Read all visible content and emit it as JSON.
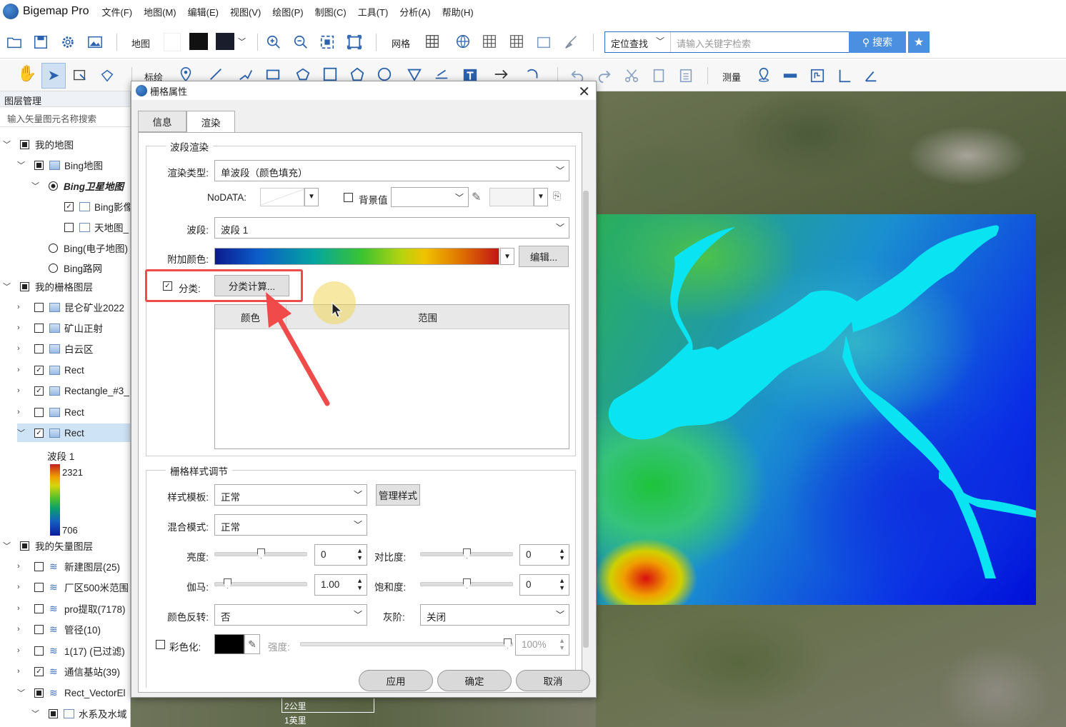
{
  "app": {
    "name": "Bigemap Pro"
  },
  "menu": [
    "文件(F)",
    "地图(M)",
    "编辑(E)",
    "视图(V)",
    "绘图(P)",
    "制图(C)",
    "工具(T)",
    "分析(A)",
    "帮助(H)"
  ],
  "toolbar1": {
    "map_label": "地图",
    "grid_label": "网格",
    "search_mode": "定位查找",
    "search_placeholder": "请输入关键字检索",
    "search_button": "搜索"
  },
  "toolbar2": {
    "annotate_label": "标绘",
    "measure_label": "测量"
  },
  "layer_panel": {
    "title": "图层管理",
    "search_placeholder": "输入矢量图元名称搜索",
    "items": [
      {
        "label": "我的地图"
      },
      {
        "label": "Bing地图"
      },
      {
        "label": "Bing卫星地图"
      },
      {
        "label": "Bing影像"
      },
      {
        "label": "天地图_"
      },
      {
        "label": "Bing(电子地图)"
      },
      {
        "label": "Bing路网"
      },
      {
        "label": "我的栅格图层"
      },
      {
        "label": "昆仑矿业2022"
      },
      {
        "label": "矿山正射"
      },
      {
        "label": "白云区"
      },
      {
        "label": "Rect"
      },
      {
        "label": "Rectangle_#3_"
      },
      {
        "label": "Rect"
      },
      {
        "label": "Rect"
      },
      {
        "label": "我的矢量图层"
      },
      {
        "label": "新建图层(25)"
      },
      {
        "label": "厂区500米范围"
      },
      {
        "label": "pro提取(7178)"
      },
      {
        "label": "管径(10)"
      },
      {
        "label": "1(17) (已过滤)"
      },
      {
        "label": "通信基站(39)"
      },
      {
        "label": "Rect_VectorEl"
      },
      {
        "label": "水系及水域"
      }
    ],
    "legend": {
      "band": "波段 1",
      "max": "2321",
      "min": "706"
    }
  },
  "map": {
    "scale_km": "2公里",
    "scale_mi": "1英里"
  },
  "dialog": {
    "title": "栅格属性",
    "tabs": [
      "信息",
      "渲染"
    ],
    "band_render": {
      "group_title": "波段渲染",
      "render_type_label": "渲染类型:",
      "render_type_value": "单波段（颜色填充）",
      "nodata_label": "NoDATA:",
      "background_label": "背景值",
      "band_label": "波段:",
      "band_value": "波段 1",
      "color_label": "附加颜色:",
      "edit_button": "编辑...",
      "classify_label": "分类:",
      "classify_button": "分类计算...",
      "table_headers": [
        "颜色",
        "范围"
      ]
    },
    "style": {
      "group_title": "栅格样式调节",
      "template_label": "样式模板:",
      "template_value": "正常",
      "manage_button": "管理样式",
      "blend_label": "混合模式:",
      "blend_value": "正常",
      "brightness_label": "亮度:",
      "brightness_value": "0",
      "contrast_label": "对比度:",
      "contrast_value": "0",
      "gamma_label": "伽马:",
      "gamma_value": "1.00",
      "saturation_label": "饱和度:",
      "saturation_value": "0",
      "invert_label": "颜色反转:",
      "invert_value": "否",
      "gray_label": "灰阶:",
      "gray_value": "关闭",
      "colorize_label": "彩色化:",
      "strength_label": "强度:",
      "strength_value": "100%"
    },
    "buttons": {
      "apply": "应用",
      "ok": "确定",
      "cancel": "取消"
    }
  }
}
